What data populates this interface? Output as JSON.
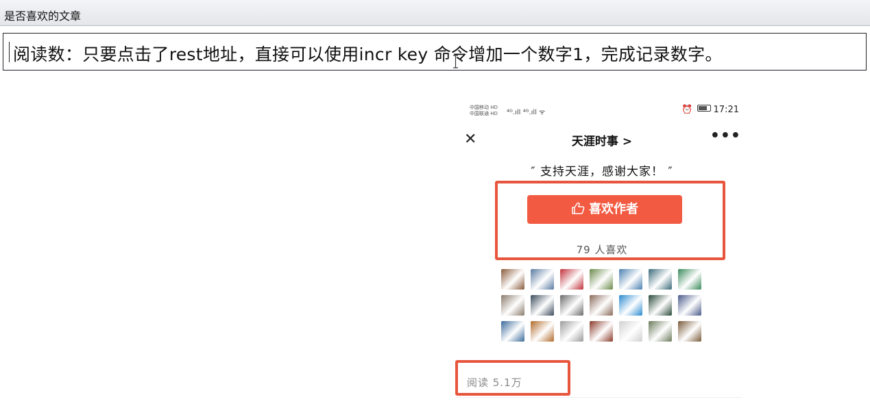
{
  "window": {
    "title": "是否喜欢的文章"
  },
  "note": {
    "text": "阅读数：只要点击了rest地址，直接可以使用incr key 命令增加一个数字1，完成记录数字。"
  },
  "phone": {
    "status": {
      "carrier_1": "中国移动 HD",
      "carrier_2": "中国联通 HD",
      "signal": "⁴ᴳ.ıll ⁴ᴳ.ıll ᯤ",
      "time": "17:21"
    },
    "nav": {
      "close_glyph": "✕",
      "title": "天涯时事 >",
      "more_glyph": "•••"
    },
    "quote": "″ 支持天涯，感谢大家！ ″",
    "like_button_label": "喜欢作者",
    "like_count": "79 人喜欢",
    "read_count": "阅读 5.1万",
    "avatar_colors": [
      "#8a5a3a",
      "#5a7aa0",
      "#c0303a",
      "#6a8a4a",
      "#4a80b0",
      "#3a6a7a",
      "#3a8a5a",
      "#8a7a6a",
      "#3a4a5a",
      "#6a6a6a",
      "#8a6a5a",
      "#2a8ad0",
      "#2a4a3a",
      "#4a5a8a",
      "#3a6a9a",
      "#b06a2a",
      "#9a9a9a",
      "#8a3a2a",
      "#d0d0d0",
      "#6a7a5a",
      "#7a5a3a"
    ],
    "accent": "#f25a42",
    "highlight_color": "#e8553d"
  }
}
